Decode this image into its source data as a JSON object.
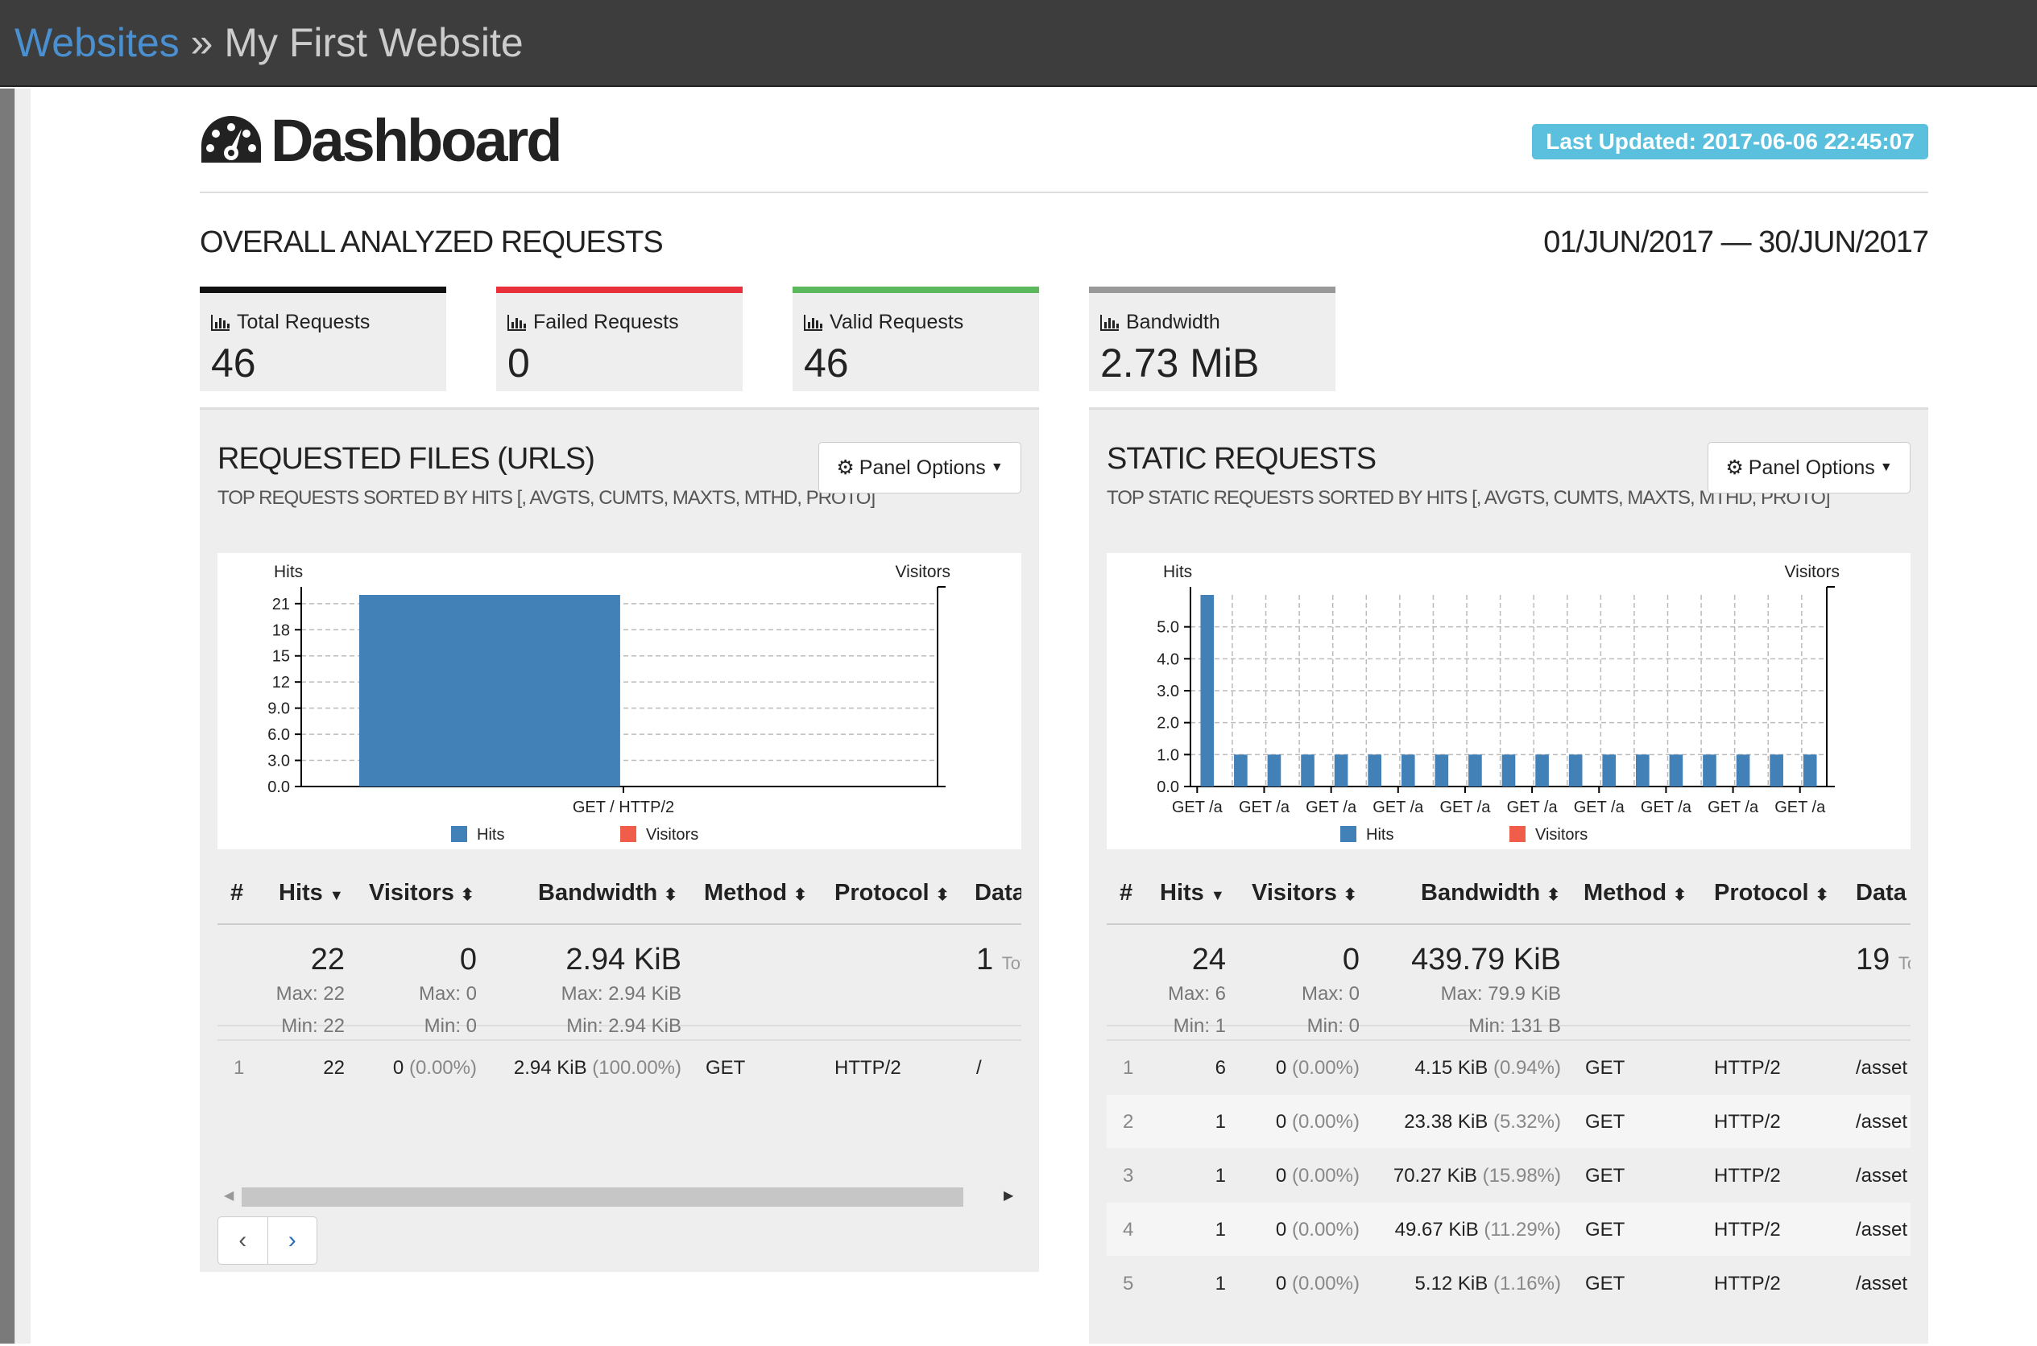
{
  "breadcrumb": {
    "parent": "Websites",
    "separator": "»",
    "current": "My First Website"
  },
  "header": {
    "title": "Dashboard",
    "last_updated": "Last Updated: 2017-06-06 22:45:07"
  },
  "overall": {
    "title": "OVERALL ANALYZED REQUESTS",
    "date_range": "01/JUN/2017 — 30/JUN/2017"
  },
  "cards": [
    {
      "label": "Total Requests",
      "value": "46",
      "color": "#111111"
    },
    {
      "label": "Failed Requests",
      "value": "0",
      "color": "#e8303a"
    },
    {
      "label": "Valid Requests",
      "value": "46",
      "color": "#5cb85c"
    },
    {
      "label": "Bandwidth",
      "value": "2.73 MiB",
      "color": "#999999"
    }
  ],
  "panel_options_label": "Panel Options",
  "requests_panel": {
    "title": "REQUESTED FILES (URLS)",
    "subtitle": "TOP REQUESTS SORTED BY HITS [, AVGTS, CUMTS, MAXTS, MTHD, PROTO]",
    "columns": [
      "#",
      "Hits",
      "Visitors",
      "Bandwidth",
      "Method",
      "Protocol",
      "Data"
    ],
    "summary": {
      "hits": "22",
      "hits_max": "Max: 22",
      "hits_min": "Min: 22",
      "visitors": "0",
      "visitors_max": "Max: 0",
      "visitors_min": "Min: 0",
      "bandwidth": "2.94 KiB",
      "bandwidth_max": "Max: 2.94 KiB",
      "bandwidth_min": "Min: 2.94 KiB",
      "data": "1",
      "data_tail": "Tot"
    },
    "rows": [
      {
        "num": "1",
        "hits": "22",
        "visitors": "0",
        "visitors_pct": "(0.00%)",
        "bandwidth": "2.94 KiB",
        "bandwidth_pct": "(100.00%)",
        "method": "GET",
        "protocol": "HTTP/2",
        "data": "/"
      }
    ]
  },
  "static_panel": {
    "title": "STATIC REQUESTS",
    "subtitle": "TOP STATIC REQUESTS SORTED BY HITS [, AVGTS, CUMTS, MAXTS, MTHD, PROTO]",
    "columns": [
      "#",
      "Hits",
      "Visitors",
      "Bandwidth",
      "Method",
      "Protocol",
      "Data"
    ],
    "summary": {
      "hits": "24",
      "hits_max": "Max: 6",
      "hits_min": "Min: 1",
      "visitors": "0",
      "visitors_max": "Max: 0",
      "visitors_min": "Min: 0",
      "bandwidth": "439.79 KiB",
      "bandwidth_max": "Max: 79.9 KiB",
      "bandwidth_min": "Min: 131 B",
      "data": "19",
      "data_tail": "To"
    },
    "rows": [
      {
        "num": "1",
        "hits": "6",
        "visitors": "0",
        "visitors_pct": "(0.00%)",
        "bandwidth": "4.15 KiB",
        "bandwidth_pct": "(0.94%)",
        "method": "GET",
        "protocol": "HTTP/2",
        "data": "/asset"
      },
      {
        "num": "2",
        "hits": "1",
        "visitors": "0",
        "visitors_pct": "(0.00%)",
        "bandwidth": "23.38 KiB",
        "bandwidth_pct": "(5.32%)",
        "method": "GET",
        "protocol": "HTTP/2",
        "data": "/asset"
      },
      {
        "num": "3",
        "hits": "1",
        "visitors": "0",
        "visitors_pct": "(0.00%)",
        "bandwidth": "70.27 KiB",
        "bandwidth_pct": "(15.98%)",
        "method": "GET",
        "protocol": "HTTP/2",
        "data": "/asset"
      },
      {
        "num": "4",
        "hits": "1",
        "visitors": "0",
        "visitors_pct": "(0.00%)",
        "bandwidth": "49.67 KiB",
        "bandwidth_pct": "(11.29%)",
        "method": "GET",
        "protocol": "HTTP/2",
        "data": "/asset"
      },
      {
        "num": "5",
        "hits": "1",
        "visitors": "0",
        "visitors_pct": "(0.00%)",
        "bandwidth": "5.12 KiB",
        "bandwidth_pct": "(1.16%)",
        "method": "GET",
        "protocol": "HTTP/2",
        "data": "/asset"
      }
    ]
  },
  "colors": {
    "hits": "#4280b8",
    "visitors": "#f05d4a",
    "accent": "#5bc0de",
    "topbar": "#3d3d3d"
  },
  "icons": [
    "dashboard-icon",
    "bar-chart-icon",
    "gear-icon",
    "caret-down-icon",
    "sort-icon",
    "chevron-left-icon",
    "chevron-right-icon"
  ],
  "chart_data": [
    {
      "type": "bar",
      "ylabel_left": "Hits",
      "ylabel_right": "Visitors",
      "categories": [
        "GET / HTTP/2"
      ],
      "series": [
        {
          "name": "Hits",
          "values": [
            22
          ]
        },
        {
          "name": "Visitors",
          "values": [
            0
          ]
        }
      ],
      "yticks": [
        "0.0",
        "3.0",
        "6.0",
        "9.0",
        "12",
        "15",
        "18",
        "21"
      ],
      "ylim": [
        0,
        22
      ],
      "legend": [
        "Hits",
        "Visitors"
      ],
      "grid": true
    },
    {
      "type": "bar",
      "ylabel_left": "Hits",
      "ylabel_right": "Visitors",
      "categories": [
        "GET /a",
        "GET /a",
        "GET /a",
        "GET /a",
        "GET /a",
        "GET /a",
        "GET /a",
        "GET /a",
        "GET /a",
        "GET /a",
        "GET /a",
        "GET /a",
        "GET /a",
        "GET /a",
        "GET /a",
        "GET /a",
        "GET /a",
        "GET /a",
        "GET /a"
      ],
      "tick_labels": [
        "GET /a",
        "GET /a",
        "GET /a",
        "GET /a",
        "GET /a",
        "GET /a",
        "GET /a",
        "GET /a",
        "GET /a",
        "GET /a"
      ],
      "series": [
        {
          "name": "Hits",
          "values": [
            6,
            1,
            1,
            1,
            1,
            1,
            1,
            1,
            1,
            1,
            1,
            1,
            1,
            1,
            1,
            1,
            1,
            1,
            1
          ]
        },
        {
          "name": "Visitors",
          "values": [
            0,
            0,
            0,
            0,
            0,
            0,
            0,
            0,
            0,
            0,
            0,
            0,
            0,
            0,
            0,
            0,
            0,
            0,
            0
          ]
        }
      ],
      "yticks": [
        "0.0",
        "1.0",
        "2.0",
        "3.0",
        "4.0",
        "5.0"
      ],
      "ylim": [
        0,
        6
      ],
      "legend": [
        "Hits",
        "Visitors"
      ],
      "grid": true
    }
  ]
}
